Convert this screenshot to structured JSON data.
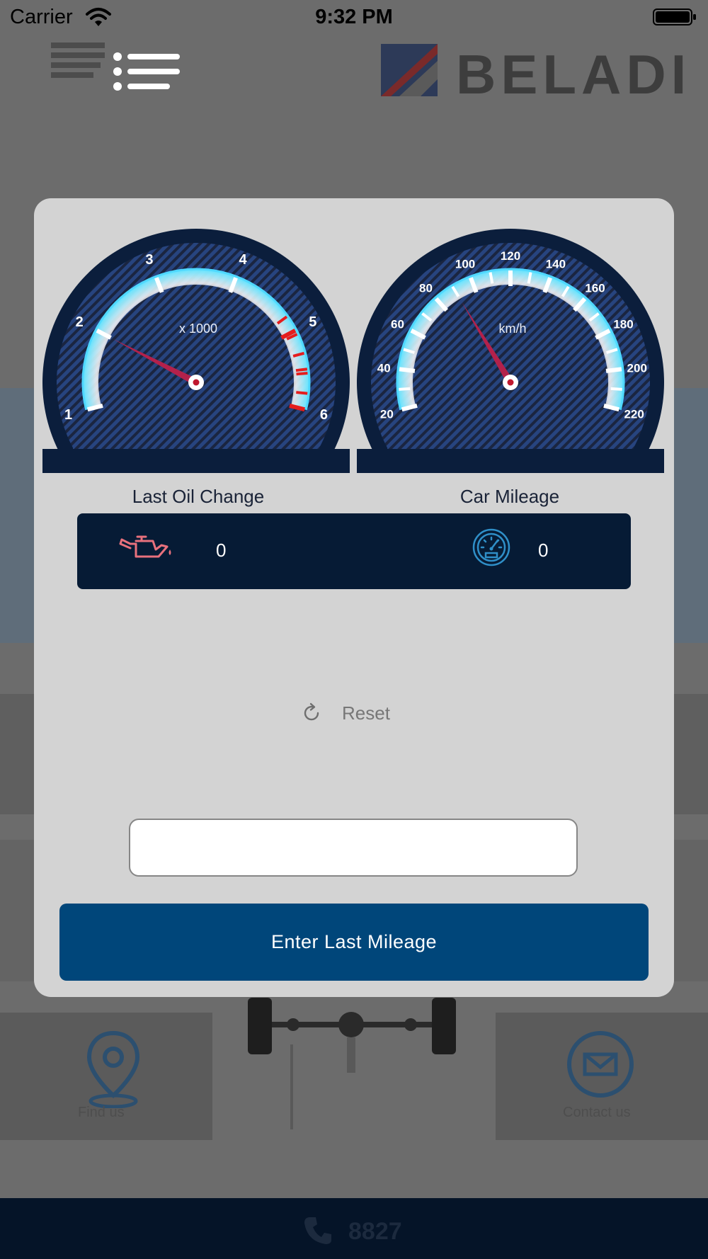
{
  "status_bar": {
    "carrier": "Carrier",
    "time": "9:32 PM"
  },
  "header": {
    "logo_text": "BELADI",
    "menu_icon": "menu-icon"
  },
  "background": {
    "map_label": "Find us",
    "contact_label": "Contact us",
    "phone_number": "8827"
  },
  "modal": {
    "rpm_gauge": {
      "unit_label": "x 1000",
      "ticks": [
        "1",
        "2",
        "3",
        "4",
        "5",
        "6"
      ],
      "needle_value": 2
    },
    "speed_gauge": {
      "unit_label": "km/h",
      "ticks": [
        "20",
        "40",
        "60",
        "80",
        "100",
        "120",
        "140",
        "160",
        "180",
        "200",
        "220"
      ],
      "needle_value": 90
    },
    "oil_change": {
      "label": "Last Oil Change",
      "value": "0",
      "icon": "oil-can-icon"
    },
    "car_mileage": {
      "label": "Car Mileage",
      "value": "0",
      "icon": "speedometer-icon"
    },
    "reset": {
      "label": "Reset",
      "icon": "refresh-icon"
    },
    "mileage_input": {
      "value": "",
      "placeholder": ""
    },
    "enter_button": {
      "label": "Enter Last Mileage"
    }
  },
  "colors": {
    "primary_button": "#00467a",
    "stats_bar": "#061b35",
    "oil_icon": "#e8717d",
    "speedo_icon": "#2f8fc8",
    "redline": "#e51d1d",
    "needle": "#b3214b"
  }
}
